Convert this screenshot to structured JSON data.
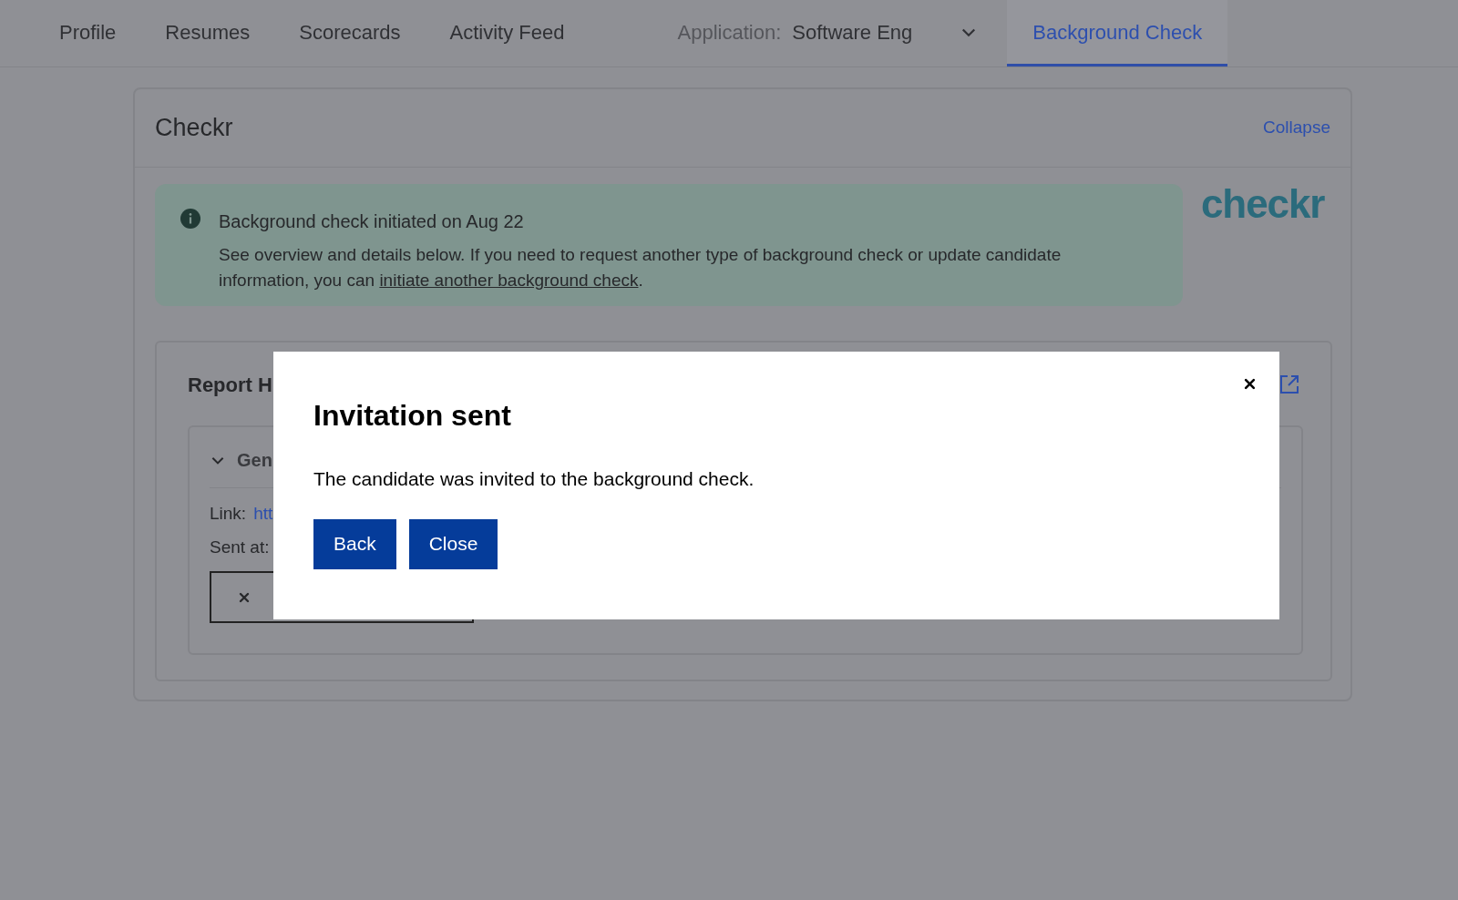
{
  "tabs": [
    {
      "kind": "plain",
      "label": "Profile",
      "selected": false
    },
    {
      "kind": "plain",
      "label": "Resumes",
      "selected": false
    },
    {
      "kind": "plain",
      "label": "Scorecards",
      "selected": false
    },
    {
      "kind": "plain",
      "label": "Activity Feed",
      "selected": false
    },
    {
      "kind": "dropdown",
      "prefix": "Application:",
      "label": "Software Eng",
      "selected": false
    },
    {
      "kind": "plain",
      "label": "Background Check",
      "selected": true
    }
  ],
  "panel": {
    "title": "Checkr",
    "collapse": "Collapse",
    "logo": "checkr",
    "banner": {
      "title": "Background check initiated on Aug 22",
      "text_before": "See overview and details below. If you need to request another type of background check or update candidate information, you can ",
      "link": "initiate another background check",
      "text_after": "."
    },
    "report": {
      "title": "Report H",
      "section": {
        "title": "Gen",
        "expanded": true,
        "link_label": "Link:",
        "link": "htt",
        "sent_label": "Sent at:"
      }
    }
  },
  "modal": {
    "title": "Invitation sent",
    "message": "The candidate was invited to the background check.",
    "buttons": [
      "Back",
      "Close"
    ]
  }
}
